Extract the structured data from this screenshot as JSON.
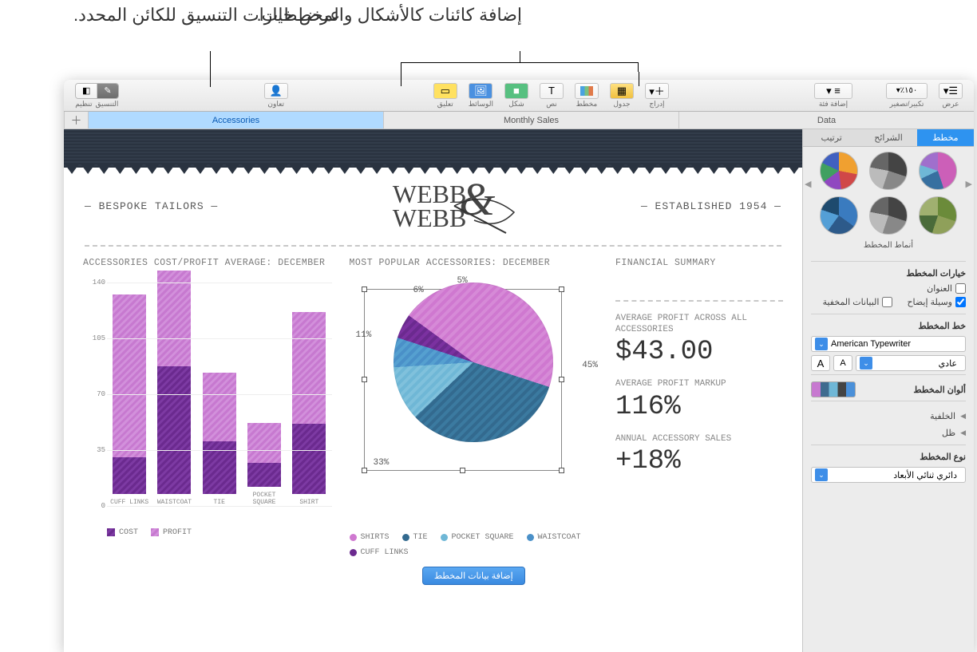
{
  "callouts": {
    "left": "عرض خيارات التنسيق\nللكائن المحدد.",
    "right": "إضافة كائنات كالأشكال\nوالمخططات."
  },
  "toolbar": {
    "view": "عرض",
    "zoom": "تكبير/تصغير",
    "zoom_value": "١٥٠٪",
    "add_category": "إضافة فئة",
    "insert": "إدراج",
    "table": "جدول",
    "chart": "مخطط",
    "text": "نص",
    "shape": "شكل",
    "media": "الوسائط",
    "comment": "تعليق",
    "collaborate": "تعاون",
    "format": "التنسيق",
    "organize": "تنظيم"
  },
  "tabs": {
    "t1": "Accessories",
    "t2": "Monthly Sales",
    "t3": "Data"
  },
  "inspector": {
    "tabs": {
      "chart": "مخطط",
      "segments": "الشرائح",
      "arrange": "ترتيب"
    },
    "styles_caption": "أنماط المخطط",
    "chart_options": "خيارات المخطط",
    "title_cb": "العنوان",
    "legend_cb": "وسيلة إيضاح",
    "hidden_cb": "البيانات المخفية",
    "chart_font": "خط المخطط",
    "font_value": "American Typewriter",
    "font_style": "عادي",
    "chart_colors": "ألوان المخطط",
    "background": "الخلفية",
    "shadow": "ظل",
    "chart_type": "نوع المخطط",
    "chart_type_value": "دائري ثنائي الأبعاد"
  },
  "header": {
    "left": "— BESPOKE TAILORS —",
    "logo1": "WEBB",
    "logo2": "WEBB",
    "right": "— ESTABLISHED 1954 —"
  },
  "sections": {
    "bar_title": "ACCESSORIES COST/PROFIT AVERAGE: DECEMBER",
    "pie_title": "MOST POPULAR ACCESSORIES: DECEMBER",
    "summary_title": "FINANCIAL SUMMARY"
  },
  "chart_data": [
    {
      "type": "bar_stacked",
      "title": "ACCESSORIES COST/PROFIT AVERAGE: DECEMBER",
      "ylim": [
        0,
        140
      ],
      "yticks": [
        0,
        35,
        70,
        105,
        140
      ],
      "categories": [
        "CUFF LINKS",
        "WAISTCOAT",
        "TIE",
        "POCKET SQUARE",
        "SHIRT"
      ],
      "series": [
        {
          "name": "COST",
          "values": [
            23,
            80,
            33,
            15,
            44
          ],
          "color": "#6b2a8f"
        },
        {
          "name": "PROFIT",
          "values": [
            102,
            60,
            43,
            25,
            70
          ],
          "color": "#c779d0"
        }
      ]
    },
    {
      "type": "pie",
      "title": "MOST POPULAR ACCESSORIES: DECEMBER",
      "slices": [
        {
          "label": "SHIRTS",
          "value": 45,
          "color": "#cf78d0"
        },
        {
          "label": "TIE",
          "value": 33,
          "color": "#336a8f"
        },
        {
          "label": "POCKET SQUARE",
          "value": 11,
          "color": "#6fb7d6"
        },
        {
          "label": "WAISTCOAT",
          "value": 6,
          "color": "#4a90c8"
        },
        {
          "label": "CUFF LINKS",
          "value": 5,
          "color": "#6b2a8f"
        }
      ]
    }
  ],
  "legend_bar": {
    "cost": "COST",
    "profit": "PROFIT"
  },
  "legend_pie": {
    "shirts": "SHIRTS",
    "tie": "TIE",
    "pocket": "POCKET SQUARE",
    "waist": "WAISTCOAT",
    "cuff": "CUFF LINKS"
  },
  "pie_labels": {
    "p45": "45%",
    "p33": "33%",
    "p11": "11%",
    "p6": "6%",
    "p5": "5%"
  },
  "summary": {
    "m1_label": "AVERAGE PROFIT ACROSS ALL ACCESSORIES",
    "m1_value": "$43.00",
    "m2_label": "AVERAGE PROFIT MARKUP",
    "m2_value": "116%",
    "m3_label": "ANNUAL ACCESSORY SALES",
    "m3_value": "+18%"
  },
  "edit_chart_btn": "إضافة بيانات المخطط"
}
